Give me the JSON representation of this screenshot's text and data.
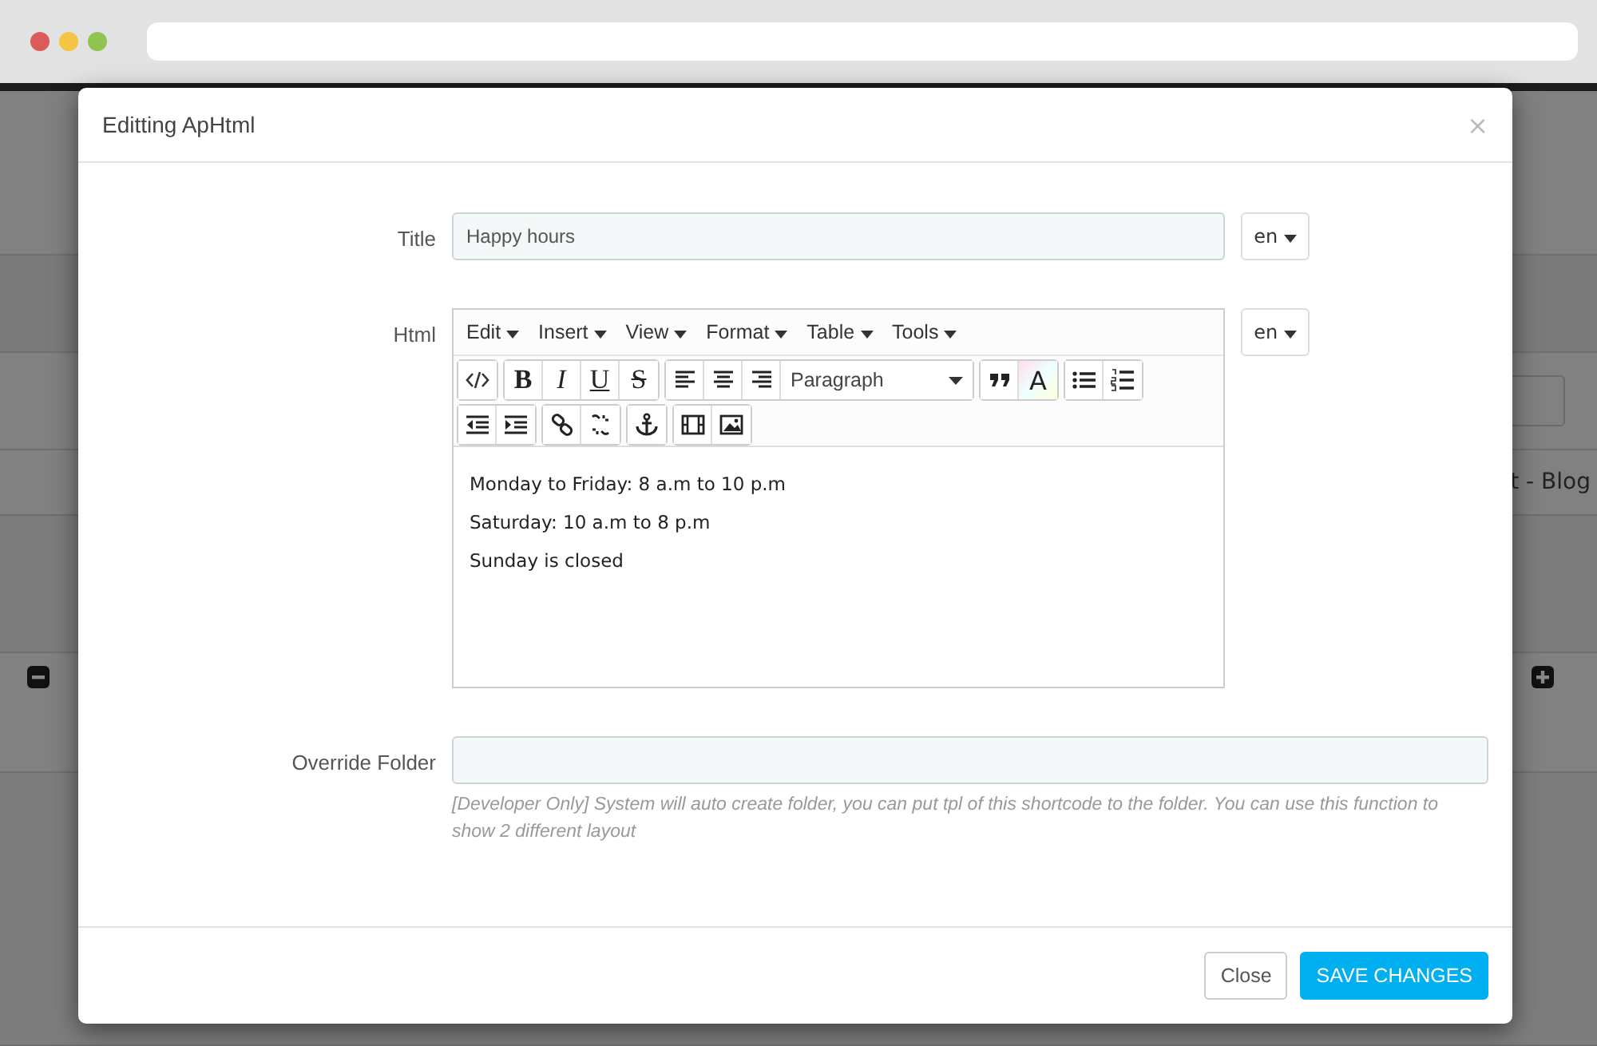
{
  "backdrop": {
    "row_text": "t - Blog"
  },
  "modal": {
    "title": "Editting ApHtml",
    "close": "×",
    "fields": [
      {
        "kind": "text",
        "label": "Title",
        "value": "Happy hours",
        "lang": "en"
      },
      {
        "kind": "editor",
        "label": "Html",
        "lang": "en",
        "menus": [
          "Edit",
          "Insert",
          "View",
          "Format",
          "Table",
          "Tools"
        ],
        "toolbar": [
          [
            [
              {
                "kind": "code"
              }
            ],
            [
              {
                "kind": "bold",
                "label": "B"
              },
              {
                "kind": "italic",
                "label": "I"
              },
              {
                "kind": "underline",
                "label": "U"
              },
              {
                "kind": "strike",
                "label": "S"
              }
            ],
            [
              {
                "kind": "align-left"
              },
              {
                "kind": "align-center"
              },
              {
                "kind": "align-right"
              },
              {
                "kind": "select",
                "label": "Paragraph"
              }
            ],
            [
              {
                "kind": "quote"
              },
              {
                "kind": "color",
                "label": "A"
              }
            ],
            [
              {
                "kind": "bullets"
              },
              {
                "kind": "numbers"
              }
            ]
          ],
          [
            [
              {
                "kind": "outdent"
              },
              {
                "kind": "indent"
              }
            ],
            [
              {
                "kind": "link"
              },
              {
                "kind": "unlink"
              }
            ],
            [
              {
                "kind": "anchor"
              }
            ],
            [
              {
                "kind": "video"
              },
              {
                "kind": "image"
              }
            ]
          ]
        ],
        "lines": [
          "Monday to Friday: 8 a.m to 10 p.m",
          "Saturday: 10 a.m to 8 p.m",
          "Sunday is closed"
        ]
      },
      {
        "kind": "wide",
        "label": "Override Folder",
        "help": "[Developer Only] System will auto create folder, you can put tpl of this shortcode to the folder. You can use this function to show 2 different layout"
      }
    ],
    "buttons": [
      {
        "label": "Close",
        "kind": "default"
      },
      {
        "label": "SAVE CHANGES",
        "kind": "primary"
      }
    ]
  }
}
